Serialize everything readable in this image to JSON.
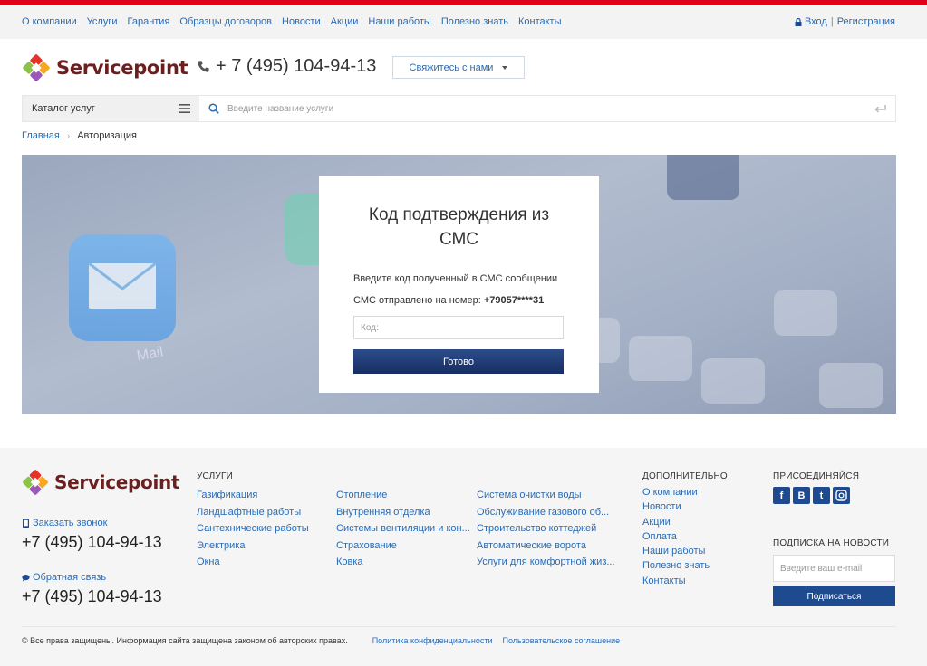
{
  "topnav": {
    "items": [
      "О компании",
      "Услуги",
      "Гарантия",
      "Образцы договоров",
      "Новости",
      "Акции",
      "Наши работы",
      "Полезно знать",
      "Контакты"
    ],
    "login": "Вход",
    "separator": "|",
    "register": "Регистрация"
  },
  "header": {
    "logo_text": "Servicepoint",
    "phone": "+ 7 (495) 104-94-13",
    "contact_button": "Свяжитесь с нами"
  },
  "search": {
    "catalog_label": "Каталог услуг",
    "placeholder": "Введите название услуги"
  },
  "breadcrumb": {
    "home": "Главная",
    "current": "Авторизация"
  },
  "hero": {
    "mail_label": "Mail"
  },
  "sms_card": {
    "title": "Код подтверждения из СМС",
    "hint": "Введите код полученный в СМС сообщении",
    "sent_label": "СМС отправлено на номер:",
    "phone_masked": "+79057****31",
    "code_placeholder": "Код:",
    "submit_label": "Готово"
  },
  "footer": {
    "logo_text": "Servicepoint",
    "callback_label": "Заказать звонок",
    "phone1": "+7 (495) 104-94-13",
    "feedback_label": "Обратная связь",
    "phone2": "+7 (495) 104-94-13",
    "services_heading": "УСЛУГИ",
    "services_col1": [
      "Газификация",
      "Ландшафтные работы",
      "Сантехнические работы",
      "Электрика",
      "Окна"
    ],
    "services_col2": [
      "Отопление",
      "Внутренняя отделка",
      "Системы вентиляции и кон...",
      "Страхование",
      "Ковка"
    ],
    "services_col3": [
      "Система очистки воды",
      "Обслуживание газового об...",
      "Строительство коттеджей",
      "Автоматические ворота",
      "Услуги для комфортной жиз..."
    ],
    "extra_heading": "ДОПОЛНИТЕЛЬНО",
    "extra_links": [
      "О компании",
      "Новости",
      "Акции",
      "Оплата",
      "Наши работы",
      "Полезно знать",
      "Контакты"
    ],
    "join_heading": "ПРИСОЕДИНЯЙСЯ",
    "social": [
      "f",
      "B",
      "t",
      "ig"
    ],
    "subscribe_heading": "ПОДПИСКА НА НОВОСТИ",
    "email_placeholder": "Введите ваш e-mail",
    "subscribe_button": "Подписаться",
    "copyright": "© Все права защищены. Информация сайта защищена законом об авторских правах.",
    "privacy": "Политика конфиденциальности",
    "terms": "Пользовательское соглашение"
  },
  "colors": {
    "top_bar": "#e1001a",
    "link": "#2a6bb3",
    "primary_button": "#1e4b8f",
    "logo_text": "#6d1f1f"
  }
}
